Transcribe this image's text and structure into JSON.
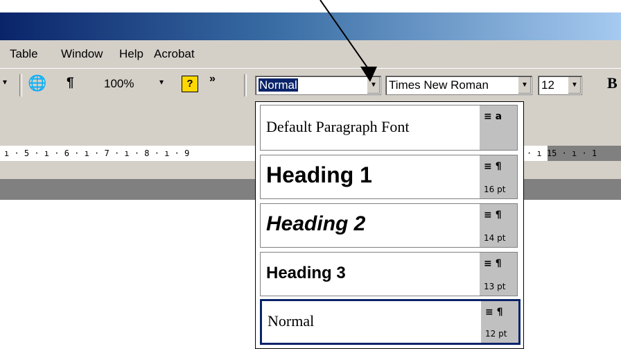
{
  "menu": {
    "items": [
      {
        "label": "Table"
      },
      {
        "label": "Window"
      },
      {
        "label": "Help"
      },
      {
        "label": "Acrobat"
      }
    ]
  },
  "toolbar": {
    "pilcrow": "¶",
    "zoom": "100%",
    "help_icon": "?",
    "overflow": "»",
    "style_value": "Normal",
    "font_value": "Times New Roman",
    "size_value": "12",
    "bold_label": "B"
  },
  "ruler": {
    "marks": "ı · 5 · ı · 6 · ı · 7 · ı · 8 · ı · 9",
    "right_marks": "· ı  15 · ı · 1"
  },
  "styles": [
    {
      "label": "Default Paragraph Font",
      "glyph": "≡ a",
      "size": ""
    },
    {
      "label": "Heading 1",
      "glyph": "≡ ¶",
      "size": "16 pt"
    },
    {
      "label": "Heading 2",
      "glyph": "≡ ¶",
      "size": "14 pt"
    },
    {
      "label": "Heading 3",
      "glyph": "≡ ¶",
      "size": "13 pt"
    },
    {
      "label": "Normal",
      "glyph": "≡ ¶",
      "size": "12 pt"
    }
  ],
  "colors": {
    "title_bar": "#0a246a",
    "chrome": "#d4d0c8",
    "selection": "#0a246a"
  }
}
